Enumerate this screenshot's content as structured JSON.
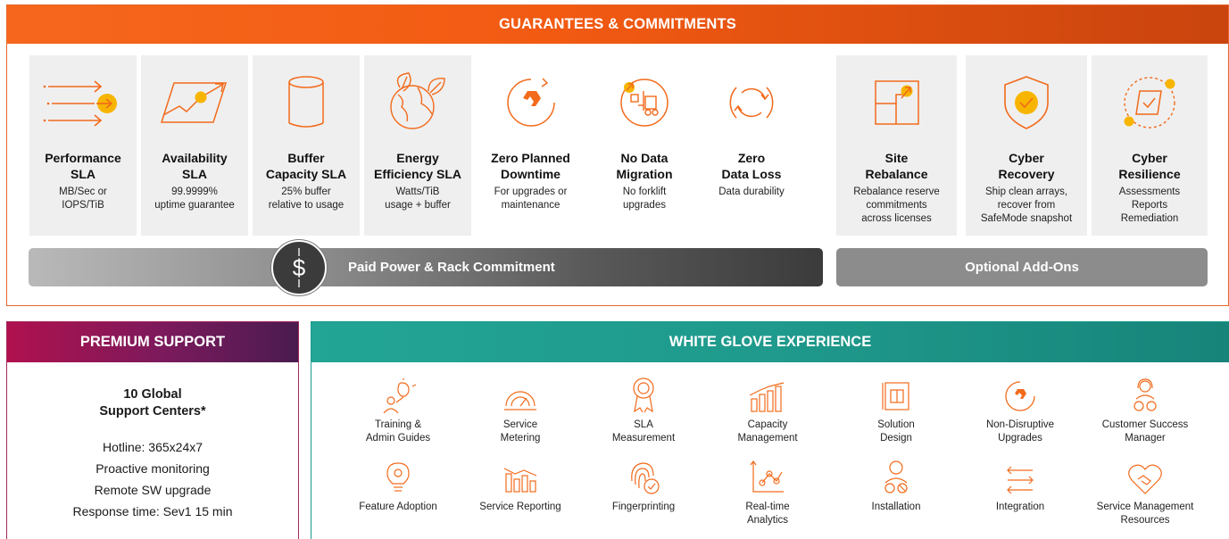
{
  "guarantees": {
    "title": "GUARANTEES & COMMITMENTS",
    "cards": [
      {
        "title": "Performance\nSLA",
        "desc": "MB/Sec or\nIOPS/TiB",
        "icon": "arrows-target-icon"
      },
      {
        "title": "Availability\nSLA",
        "desc": "99.9999%\nuptime guarantee",
        "icon": "uptime-graph-icon"
      },
      {
        "title": "Buffer\nCapacity SLA",
        "desc": "25% buffer\nrelative to usage",
        "icon": "cylinder-icon"
      },
      {
        "title": "Energy\nEfficiency SLA",
        "desc": "Watts/TiB\nusage + buffer",
        "icon": "globe-leaves-icon"
      },
      {
        "title": "Zero Planned\nDowntime",
        "desc": "For upgrades or\nmaintenance",
        "icon": "logo-circle-icon"
      },
      {
        "title": "No Data\nMigration",
        "desc": "No forklift\nupgrades",
        "icon": "forklift-icon"
      },
      {
        "title": "Zero\nData Loss",
        "desc": "Data durability",
        "icon": "circular-arrows-icon"
      },
      {
        "title": "Site\nRebalance",
        "desc": "Rebalance  reserve\ncommitments\nacross licenses",
        "icon": "rebalance-icon"
      },
      {
        "title": "Cyber\nRecovery",
        "desc": "Ship clean arrays,\nrecover from\nSafeMode snapshot",
        "icon": "shield-check-icon"
      },
      {
        "title": "Cyber\nResilience",
        "desc": "Assessments\nReports\nRemediation",
        "icon": "dashed-circle-check-icon"
      }
    ],
    "paid_bar": "Paid Power & Rack Commitment",
    "optional_bar": "Optional Add-Ons",
    "dollar_symbol": "$"
  },
  "premium": {
    "title": "PREMIUM SUPPORT",
    "heading": "10 Global\nSupport Centers*",
    "lines": [
      "Hotline: 365x24x7",
      "Proactive monitoring",
      "Remote SW upgrade",
      "Response time: Sev1 15 min"
    ]
  },
  "white_glove": {
    "title": "WHITE GLOVE EXPERIENCE",
    "items": [
      {
        "label": "Training &\nAdmin Guides",
        "icon": "lightbulb-person-icon"
      },
      {
        "label": "Service\nMetering",
        "icon": "gauge-icon"
      },
      {
        "label": "SLA\nMeasurement",
        "icon": "ribbon-icon"
      },
      {
        "label": "Capacity\nManagement",
        "icon": "bar-growth-icon"
      },
      {
        "label": "Solution\nDesign",
        "icon": "blueprint-icon"
      },
      {
        "label": "Non-Disruptive\nUpgrades",
        "icon": "logo-circle-icon"
      },
      {
        "label": "Customer Success\nManager",
        "icon": "headset-people-icon"
      },
      {
        "label": "Feature Adoption",
        "icon": "bulb-gear-icon"
      },
      {
        "label": "Service Reporting",
        "icon": "bar-report-icon"
      },
      {
        "label": "Fingerprinting",
        "icon": "fingerprint-icon"
      },
      {
        "label": "Real-time\nAnalytics",
        "icon": "analytics-chart-icon"
      },
      {
        "label": "Installation",
        "icon": "person-gears-icon"
      },
      {
        "label": "Integration",
        "icon": "arrows-exchange-icon"
      },
      {
        "label": "Service Management\nResources",
        "icon": "heart-handshake-icon"
      }
    ]
  },
  "colors": {
    "orange": "#f26a1b",
    "orange_dark": "#c9440e",
    "magenta": "#b0114e",
    "purple": "#4a1b4f",
    "teal": "#1f9a8c",
    "card_bg": "#efefef",
    "icon_yellow": "#f7b500"
  }
}
